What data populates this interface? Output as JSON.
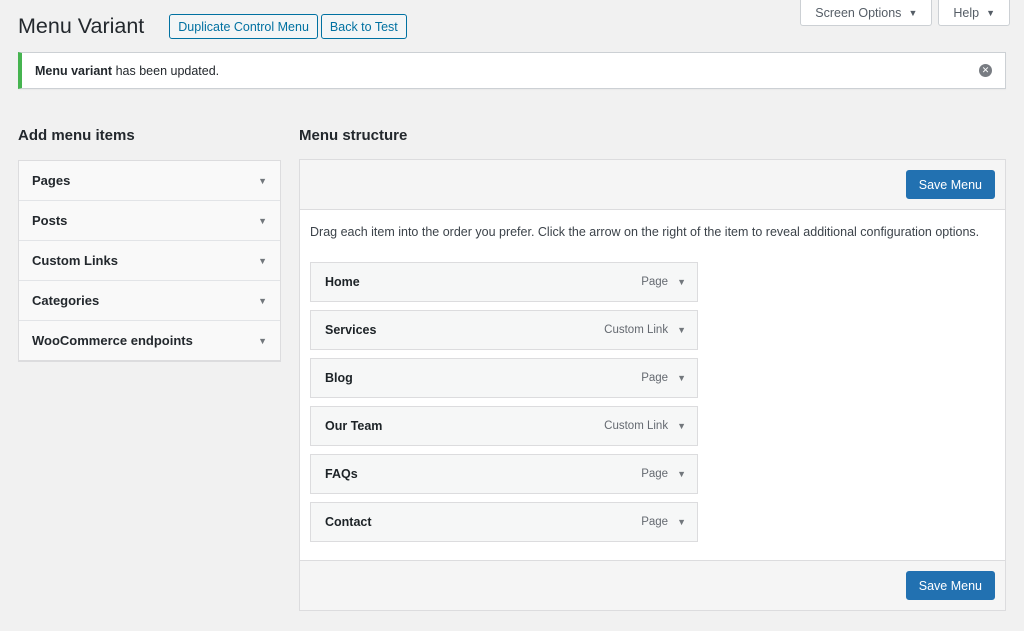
{
  "screen_meta": {
    "screen_options": "Screen Options",
    "help": "Help"
  },
  "header": {
    "title": "Menu Variant",
    "duplicate_button": "Duplicate Control Menu",
    "back_button": "Back to Test"
  },
  "notice": {
    "strong": "Menu variant",
    "message": " has been updated."
  },
  "add_menu_items": {
    "heading": "Add menu items",
    "sections": [
      "Pages",
      "Posts",
      "Custom Links",
      "Categories",
      "WooCommerce endpoints"
    ]
  },
  "menu_structure": {
    "heading": "Menu structure",
    "save_label": "Save Menu",
    "instructions": "Drag each item into the order you prefer. Click the arrow on the right of the item to reveal additional configuration options.",
    "items": [
      {
        "title": "Home",
        "type": "Page"
      },
      {
        "title": "Services",
        "type": "Custom Link"
      },
      {
        "title": "Blog",
        "type": "Page"
      },
      {
        "title": "Our Team",
        "type": "Custom Link"
      },
      {
        "title": "FAQs",
        "type": "Page"
      },
      {
        "title": "Contact",
        "type": "Page"
      }
    ]
  },
  "icons": {
    "caret": "caret-down-icon",
    "dismiss": "dismiss-icon"
  },
  "colors": {
    "accent": "#2271b1",
    "success": "#46b450",
    "secondary_button": "#0071a1"
  }
}
